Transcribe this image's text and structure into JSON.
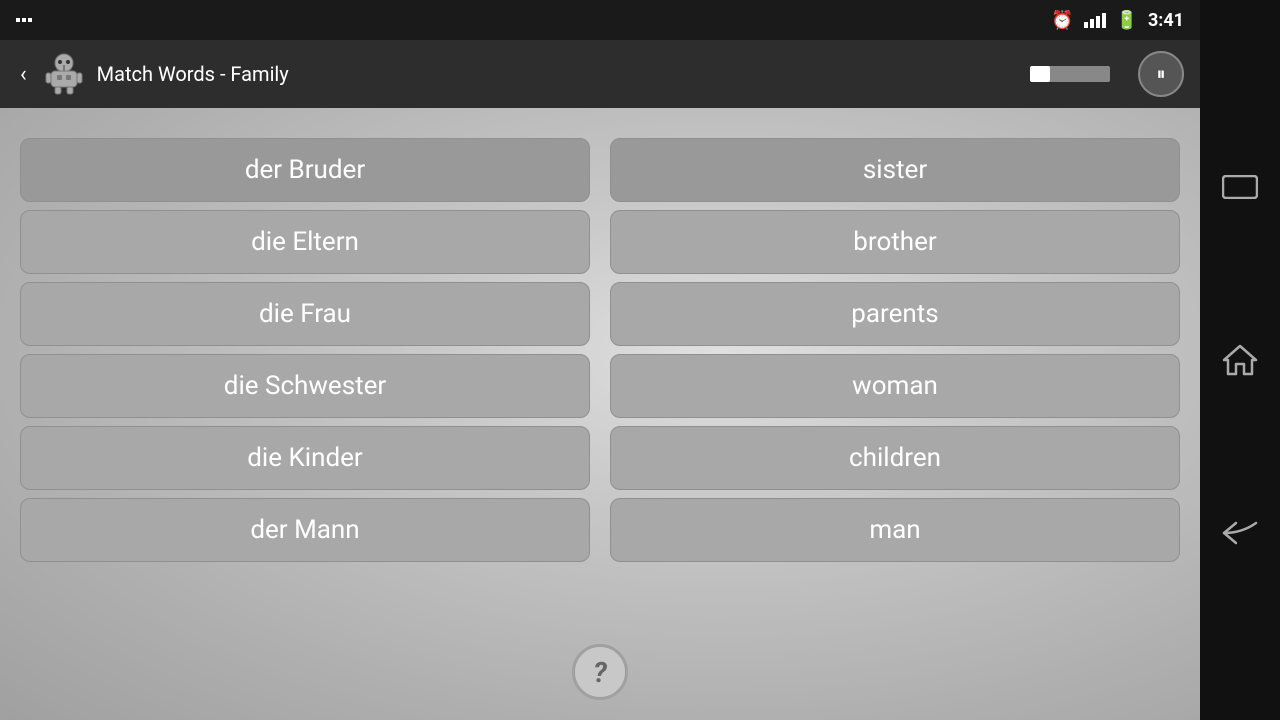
{
  "statusBar": {
    "time": "3:41",
    "batteryLevel": 80,
    "signalStrength": 4
  },
  "appBar": {
    "title": "Match Words - Family",
    "progressPercent": 25,
    "backLabel": "‹",
    "pauseIcon": "⏸"
  },
  "leftColumn": {
    "cards": [
      {
        "id": "lc1",
        "text": "der Bruder"
      },
      {
        "id": "lc2",
        "text": "die Eltern"
      },
      {
        "id": "lc3",
        "text": "die Frau"
      },
      {
        "id": "lc4",
        "text": "die Schwester"
      },
      {
        "id": "lc5",
        "text": "die Kinder"
      },
      {
        "id": "lc6",
        "text": "der Mann"
      }
    ]
  },
  "rightColumn": {
    "cards": [
      {
        "id": "rc1",
        "text": "sister"
      },
      {
        "id": "rc2",
        "text": "brother"
      },
      {
        "id": "rc3",
        "text": "parents"
      },
      {
        "id": "rc4",
        "text": "woman"
      },
      {
        "id": "rc5",
        "text": "children"
      },
      {
        "id": "rc6",
        "text": "man"
      }
    ]
  },
  "helpButton": {
    "label": "?"
  },
  "navButtons": {
    "rectangleIcon": "▭",
    "homeIcon": "⌂",
    "backIcon": "↩"
  }
}
